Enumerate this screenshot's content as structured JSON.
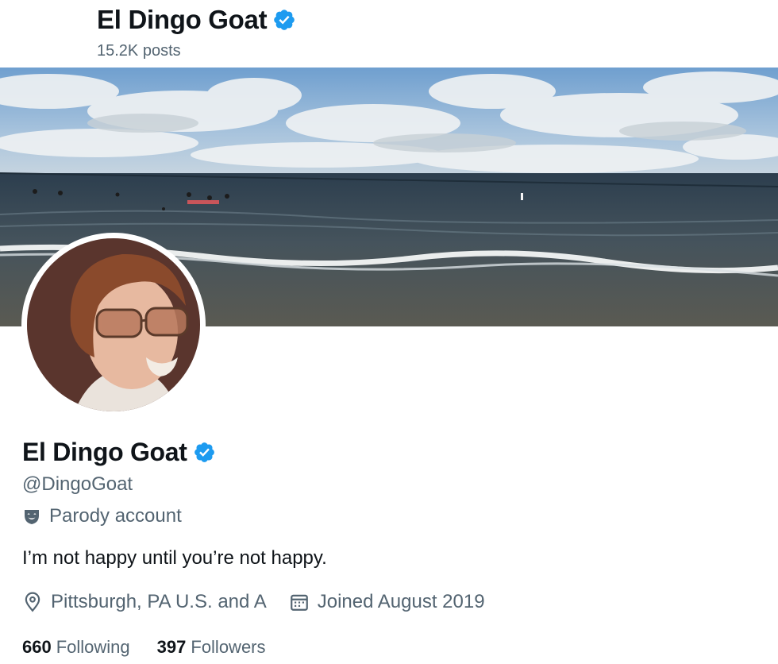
{
  "header": {
    "name": "El Dingo Goat",
    "posts": "15.2K posts"
  },
  "profile": {
    "name": "El Dingo Goat",
    "handle": "@DingoGoat",
    "label": "Parody account",
    "bio": "I’m not happy until you’re not happy.",
    "location": "Pittsburgh, PA U.S. and A",
    "joined": "Joined August 2019"
  },
  "stats": {
    "following_count": "660",
    "following_label": "Following",
    "followers_count": "397",
    "followers_label": "Followers"
  },
  "colors": {
    "verified": "#1d9bf0",
    "secondary_text": "#536471",
    "primary_text": "#0f1419"
  },
  "icons": {
    "verified": "verified-badge-icon",
    "parody": "parody-mask-icon",
    "location": "location-pin-icon",
    "calendar": "calendar-icon"
  }
}
